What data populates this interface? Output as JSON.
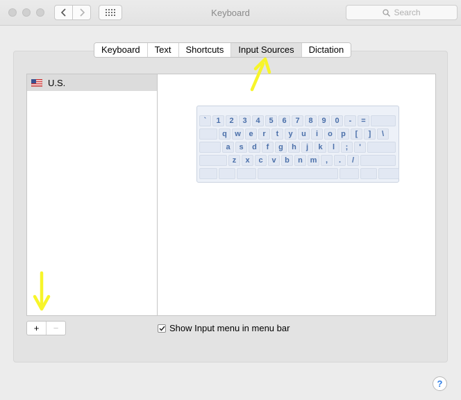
{
  "window": {
    "title": "Keyboard"
  },
  "search": {
    "placeholder": "Search"
  },
  "tabs": [
    {
      "label": "Keyboard",
      "active": false
    },
    {
      "label": "Text",
      "active": false
    },
    {
      "label": "Shortcuts",
      "active": false
    },
    {
      "label": "Input Sources",
      "active": true
    },
    {
      "label": "Dictation",
      "active": false
    }
  ],
  "sources": [
    {
      "label": "U.S.",
      "icon": "us-flag-icon",
      "selected": true
    }
  ],
  "keyboard_rows": [
    [
      "`",
      "1",
      "2",
      "3",
      "4",
      "5",
      "6",
      "7",
      "8",
      "9",
      "0",
      "-",
      "=",
      ""
    ],
    [
      "",
      "q",
      "w",
      "e",
      "r",
      "t",
      "y",
      "u",
      "i",
      "o",
      "p",
      "[",
      "]",
      "\\"
    ],
    [
      "",
      "a",
      "s",
      "d",
      "f",
      "g",
      "h",
      "j",
      "k",
      "l",
      ";",
      "'",
      ""
    ],
    [
      "",
      "z",
      "x",
      "c",
      "v",
      "b",
      "n",
      "m",
      ",",
      ".",
      "/",
      ""
    ]
  ],
  "buttons": {
    "add": "+",
    "remove": "−"
  },
  "show_input_menu": {
    "label": "Show Input menu in menu bar",
    "checked": true
  },
  "help": {
    "label": "?"
  },
  "colors": {
    "annotation": "#f7f52a",
    "key_text": "#4a6fa9"
  }
}
